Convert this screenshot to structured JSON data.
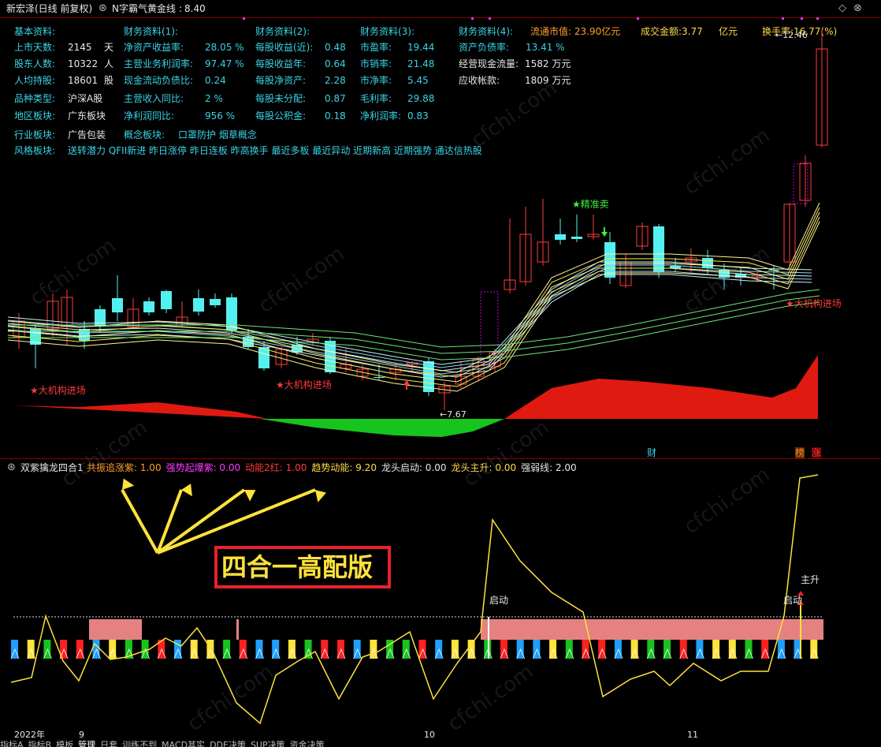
{
  "header": {
    "stock_title": "新宏泽(日线 前复权)",
    "indicator_name": "N字霸气黄金线",
    "indicator_value": "8.40",
    "minimize_glyph": "◇",
    "close_glyph": "⊗"
  },
  "info": {
    "col1_title": "基本资料:",
    "col2_title": "财务资料(1):",
    "col3_title": "财务资料(2):",
    "col4_title": "财务资料(3):",
    "col5_title": "财务资料(4):",
    "market_cap_label": "流通市值: 23.90亿元",
    "turnover_amount": "成交金额:3.77",
    "turnover_unit": "亿元",
    "turnover_rate": "换手率:16.77(%)",
    "basic": [
      {
        "k": "上市天数:",
        "v": "2145",
        "u": "天"
      },
      {
        "k": "股东人数:",
        "v": "10322",
        "u": "人"
      },
      {
        "k": "人均持股:",
        "v": "18601",
        "u": "股"
      },
      {
        "k": "品种类型:",
        "v": "沪深A股",
        "u": ""
      },
      {
        "k": "地区板块:",
        "v": "广东板块",
        "u": ""
      },
      {
        "k": "行业板块:",
        "v": "广告包装",
        "u": ""
      }
    ],
    "fin1": [
      {
        "k": "净资产收益率:",
        "v": "28.05 %"
      },
      {
        "k": "主营业务利润率:",
        "v": "97.47 %"
      },
      {
        "k": "现金流动负债比:",
        "v": "0.24"
      },
      {
        "k": "主营收入同比:",
        "v": "2 %"
      },
      {
        "k": "净利润同比:",
        "v": "956 %"
      }
    ],
    "fin2": [
      {
        "k": "每股收益(近):",
        "v": "0.48"
      },
      {
        "k": "每股收益年:",
        "v": "0.64"
      },
      {
        "k": "每股净资产:",
        "v": "2.28"
      },
      {
        "k": "每股未分配:",
        "v": "0.87"
      },
      {
        "k": "每股公积金:",
        "v": "0.18"
      }
    ],
    "fin3": [
      {
        "k": "市盈率:",
        "v": "19.44"
      },
      {
        "k": "市销率:",
        "v": "21.48"
      },
      {
        "k": "市净率:",
        "v": "5.45"
      },
      {
        "k": "毛利率:",
        "v": "29.88"
      },
      {
        "k": "净利润率:",
        "v": "0.83"
      }
    ],
    "fin4": [
      {
        "k": "资产负债率:",
        "v": "13.41 %"
      },
      {
        "k": "经营现金流量:",
        "v": "1582 万元"
      },
      {
        "k": "应收帐款:",
        "v": "1809 万元"
      }
    ],
    "concept_label": "概念板块:",
    "concept_value": "口罩防护 烟草概念",
    "style_label": "风格板块:",
    "style_value": "送转潜力 QFII新进 昨日涨停 昨日连板 昨高换手 最近多板 最近异动 近期新高 近期强势 通达信热股"
  },
  "chart_labels": {
    "institution_in_1": "★大机构进场",
    "institution_in_2": "★大机构进场",
    "institution_in_3": "★大机构进场",
    "precise_sell": "★精准卖",
    "low_price": "←7.67",
    "high_price": "←12.46",
    "cai_badge": "财",
    "bang_badge": "榜",
    "zhang_badge": "涨"
  },
  "sub_panel": {
    "name": "双紫擒龙四合1",
    "items": [
      {
        "label": "共振追涨紫:",
        "value": "1.00",
        "color": "#ff9f2a"
      },
      {
        "label": "强势起爆紫:",
        "value": "0.00",
        "color": "#ff3bff"
      },
      {
        "label": "动能2红:",
        "value": "1.00",
        "color": "#ff3b3b"
      },
      {
        "label": "趋势动能:",
        "value": "9.20",
        "color": "#ffd84a"
      },
      {
        "label": "龙头启动:",
        "value": "0.00",
        "color": "#e8e8e8"
      },
      {
        "label": "龙头主升:",
        "value": "0.00",
        "color": "#ffd84a"
      },
      {
        "label": "强弱线:",
        "value": "2.00",
        "color": "#e8e8e8"
      }
    ],
    "promo_text": "四合一高配版",
    "start_label_1": "启动",
    "start_label_2": "启动",
    "main_rise_label": "主升"
  },
  "axis": {
    "year_label": "2022年",
    "month_9": "9",
    "month_10": "10",
    "month_11": "11"
  },
  "bottom_tabs": [
    "指标A",
    "指标B",
    "模板",
    "管理",
    "日套",
    "训练不到",
    "MACD其实",
    "DDE决策",
    "SUP决策",
    "资金决策"
  ],
  "watermark": "cfchi.com",
  "colors": {
    "up": "#ff3b3b",
    "down": "#54f0f0",
    "institution_red": "#e01a10",
    "institution_green": "#17c41d",
    "trend_yellow": "#ffe23a"
  }
}
